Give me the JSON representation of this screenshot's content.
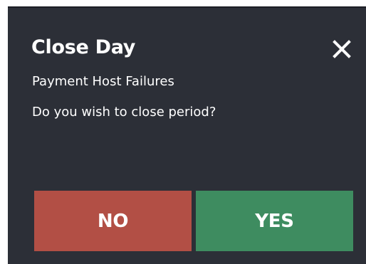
{
  "dialog": {
    "title": "Close Day",
    "subtitle": "Payment Host Failures",
    "question": "Do you wish to close period?",
    "close_icon": "close-icon",
    "buttons": {
      "no_label": "NO",
      "yes_label": "YES"
    }
  },
  "colors": {
    "dialog_background": "#2c2f37",
    "text": "#ffffff",
    "no_button": "#b24f45",
    "yes_button": "#3e8c60"
  }
}
